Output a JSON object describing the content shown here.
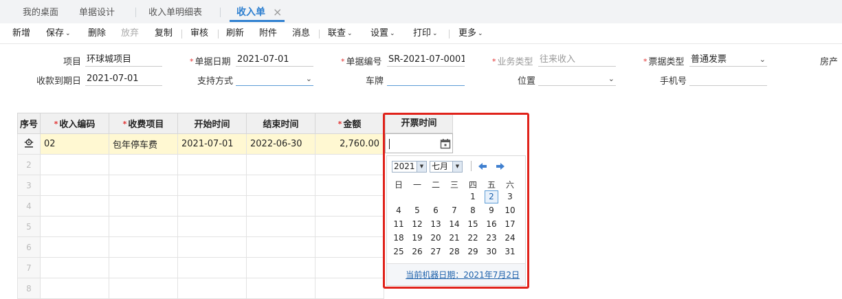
{
  "tabs": [
    {
      "label": "我的桌面",
      "active": false
    },
    {
      "label": "单据设计",
      "active": false
    },
    {
      "label": "收入单明细表",
      "active": false
    },
    {
      "label": "收入单",
      "active": true
    }
  ],
  "tab_close_glyph": "×",
  "toolbar": {
    "new": "新增",
    "save": "保存",
    "delete": "删除",
    "discard": "放弃",
    "copy": "复制",
    "audit": "审核",
    "refresh": "刷新",
    "attachment": "附件",
    "message": "消息",
    "link_query": "联查",
    "settings": "设置",
    "print": "打印",
    "more": "更多",
    "caret": "⌄"
  },
  "form": {
    "project_label": "项目",
    "project_value": "环球城项目",
    "doc_date_label": "单据日期",
    "doc_date_value": "2021-07-01",
    "doc_no_label": "单据编号",
    "doc_no_value": "SR-2021-07-0001",
    "biz_type_label": "业务类型",
    "biz_type_value": "往来收入",
    "bill_type_label": "票据类型",
    "bill_type_value": "普通发票",
    "house_label": "房产",
    "due_date_label": "收款到期日",
    "due_date_value": "2021-07-01",
    "pay_method_label": "支持方式",
    "pay_method_value": "",
    "plate_label": "车牌",
    "plate_value": "",
    "position_label": "位置",
    "position_value": "",
    "phone_label": "手机号",
    "phone_value": "",
    "dropdown_glyph": "⌄"
  },
  "grid": {
    "columns": [
      "序号",
      "收入编码",
      "收费项目",
      "开始时间",
      "结束时间",
      "金额",
      "开票时间"
    ],
    "rows": [
      {
        "no": "",
        "code": "02",
        "item": "包年停车费",
        "start": "2021-07-01",
        "end": "2022-06-30",
        "amount": "2,760.00"
      },
      {
        "no": "2"
      },
      {
        "no": "3"
      },
      {
        "no": "4"
      },
      {
        "no": "5"
      },
      {
        "no": "6"
      },
      {
        "no": "7"
      },
      {
        "no": "8"
      }
    ]
  },
  "calendar": {
    "year": "2021",
    "month": "七月",
    "weekdays": [
      "日",
      "一",
      "二",
      "三",
      "四",
      "五",
      "六"
    ],
    "today": "2",
    "weeks": [
      [
        "",
        "",
        "",
        "",
        "1",
        "2",
        "3"
      ],
      [
        "4",
        "5",
        "6",
        "7",
        "8",
        "9",
        "10"
      ],
      [
        "11",
        "12",
        "13",
        "14",
        "15",
        "16",
        "17"
      ],
      [
        "18",
        "19",
        "20",
        "21",
        "22",
        "23",
        "24"
      ],
      [
        "25",
        "26",
        "27",
        "28",
        "29",
        "30",
        "31"
      ]
    ],
    "footer": "当前机器日期：2021年7月2日"
  },
  "colors": {
    "accent": "#2d7fd0",
    "highlight_border": "#e0221a",
    "selected_row": "#fff8d2"
  }
}
